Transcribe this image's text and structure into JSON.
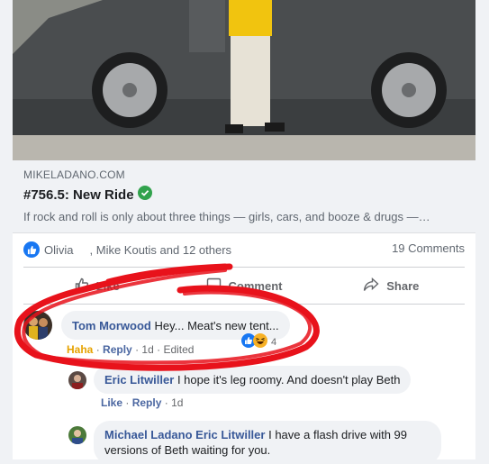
{
  "link_preview": {
    "domain": "MIKELADANO.COM",
    "title": "#756.5: New Ride",
    "description": "If rock and roll is only about three things — girls, cars, and booze & drugs —…"
  },
  "reactions": {
    "first_name": "Olivia",
    "others": ", Mike Koutis and 12 others",
    "comments_count": "19 Comments"
  },
  "actions": {
    "like": "Like",
    "comment": "Comment",
    "share": "Share"
  },
  "comments": [
    {
      "author": "Tom Morwood",
      "text": "Hey... Meat's new tent...",
      "reaction_label": "Haha",
      "reply": "Reply",
      "time": "1d",
      "edited": "Edited",
      "reaction_count": "4"
    },
    {
      "author": "Eric Litwiller",
      "text": "I hope it's leg roomy. And doesn't play Beth",
      "like": "Like",
      "reply": "Reply",
      "time": "1d"
    },
    {
      "author": "Michael Ladano",
      "mention": "Eric Litwiller",
      "text_line1": "I have a flash drive with 99",
      "text_line2": "versions of Beth waiting for you."
    }
  ],
  "colors": {
    "brand_blue": "#1877f2",
    "name_blue": "#385898",
    "haha_yellow": "#e6a200",
    "scribble_red": "#e8121b",
    "verified_green": "#31a24c"
  }
}
